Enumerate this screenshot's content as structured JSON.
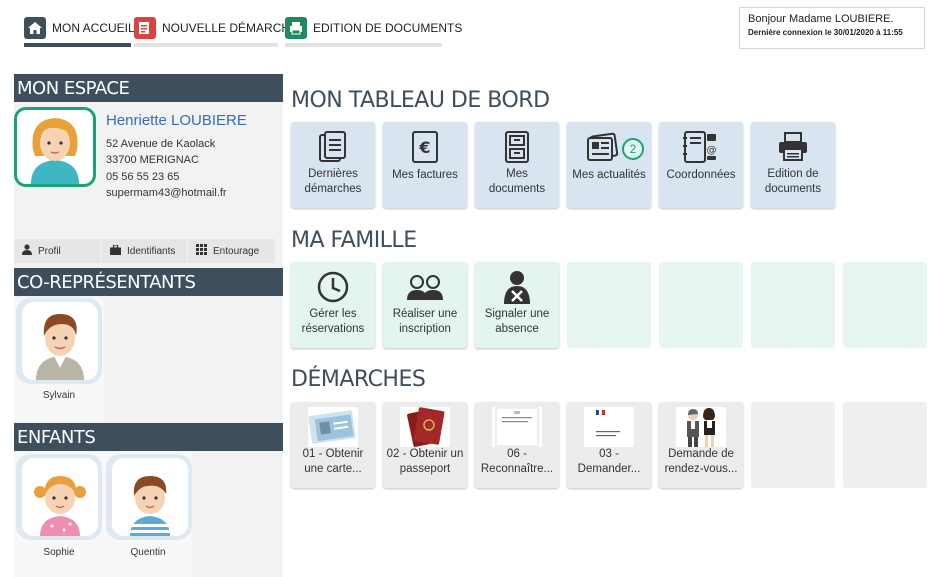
{
  "nav": {
    "home": "MON ACCUEIL",
    "new_request": "NOUVELLE DÉMARCHE",
    "docs": "EDITION DE DOCUMENTS"
  },
  "greeting": {
    "line1": "Bonjour Madame LOUBIERE.",
    "line2": "Dernière connexion le 30/01/2020 à 11:55"
  },
  "sidebar": {
    "mon_espace": "MON ESPACE",
    "profile": {
      "name": "Henriette LOUBIERE",
      "address1": "52 Avenue de Kaolack",
      "address2": "33700 MERIGNAC",
      "phone": "05 56 55 23 65",
      "email": "supermam43@hotmail.fr"
    },
    "subtabs": {
      "profil": "Profil",
      "identifiants": "Identifiants",
      "entourage": "Entourage"
    },
    "co_title": "CO-REPRÉSENTANTS",
    "co_reps": [
      {
        "name": "Sylvain"
      }
    ],
    "children_title": "ENFANTS",
    "children": [
      {
        "name": "Sophie"
      },
      {
        "name": "Quentin"
      }
    ]
  },
  "dashboard": {
    "title": "MON TABLEAU DE BORD",
    "tiles": [
      {
        "label": "Dernières démarches",
        "icon": "document-list-icon"
      },
      {
        "label": "Mes factures",
        "icon": "euro-invoice-icon"
      },
      {
        "label": "Mes documents",
        "icon": "filing-cabinet-icon"
      },
      {
        "label": "Mes actualités",
        "icon": "newspaper-icon",
        "badge": "2"
      },
      {
        "label": "Coordonnées",
        "icon": "address-book-icon"
      },
      {
        "label": "Edition de documents",
        "icon": "printer-icon"
      }
    ]
  },
  "family": {
    "title": "MA FAMILLE",
    "tiles": [
      {
        "label": "Gérer les réservations",
        "icon": "clock-icon"
      },
      {
        "label": "Réaliser une inscription",
        "icon": "people-icon"
      },
      {
        "label": "Signaler une absence",
        "icon": "person-cross-icon"
      }
    ]
  },
  "demarches": {
    "title": "DÉMARCHES",
    "tiles": [
      {
        "label": "01 - Obtenir une carte...",
        "icon": "id-card-thumbnail"
      },
      {
        "label": "02 - Obtenir un passeport",
        "icon": "passport-thumbnail"
      },
      {
        "label": "06 - Reconnaître...",
        "icon": "document-thumbnail"
      },
      {
        "label": "03 - Demander...",
        "icon": "civil-status-thumbnail"
      },
      {
        "label": "Demande de rendez-vous...",
        "icon": "meeting-thumbnail"
      }
    ]
  },
  "colors": {
    "header_bar": "#3e4e5c",
    "accent_green": "#1aa37a",
    "link_blue": "#2f6fb5"
  }
}
